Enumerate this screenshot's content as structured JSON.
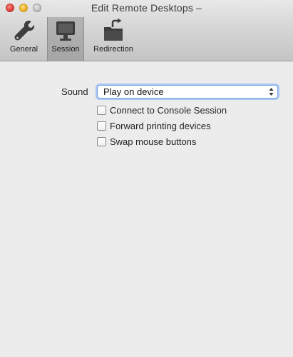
{
  "window": {
    "title": "Edit Remote Desktops –"
  },
  "toolbar": {
    "items": [
      {
        "label": "General",
        "icon": "wrench-icon",
        "selected": false
      },
      {
        "label": "Session",
        "icon": "monitor-icon",
        "selected": true
      },
      {
        "label": "Redirection",
        "icon": "folder-redirect-icon",
        "selected": false
      }
    ]
  },
  "session": {
    "sound_label": "Sound",
    "sound_select": {
      "value": "Play on device"
    },
    "checkboxes": [
      {
        "label": "Connect to Console Session",
        "checked": false
      },
      {
        "label": "Forward printing devices",
        "checked": false
      },
      {
        "label": "Swap mouse buttons",
        "checked": false
      }
    ]
  },
  "colors": {
    "window_background": "#ececec",
    "focus_ring": "#7aa7e6",
    "close_button": "#e0443e",
    "minimize_button": "#f0b428"
  }
}
